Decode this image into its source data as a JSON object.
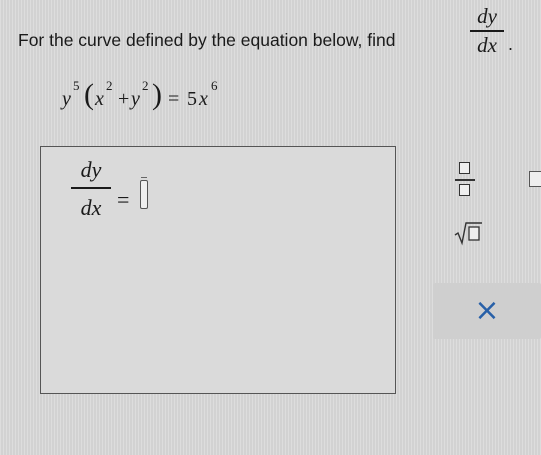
{
  "question": {
    "prompt": "For the curve defined by the equation below, find",
    "derivative_num": "dy",
    "derivative_den": "dx",
    "period": "."
  },
  "equation": {
    "y": "y",
    "y_exp": "5",
    "open_paren": "(",
    "x": "x",
    "x_exp": "2",
    "plus": "+",
    "y2": "y",
    "y2_exp": "2",
    "close_paren": ")",
    "equals": "=",
    "coef": "5",
    "x2": "x",
    "x2_exp": "6"
  },
  "answer": {
    "label_num": "dy",
    "label_den": "dx",
    "equals": "=",
    "value": ""
  },
  "palette": {
    "fraction_icon": "fraction-template-icon",
    "mixed_icon": "mixed-number-template-icon",
    "sqrt_icon": "square-root-template-icon",
    "clear_label": "×",
    "accent_color": "#2860a8"
  }
}
